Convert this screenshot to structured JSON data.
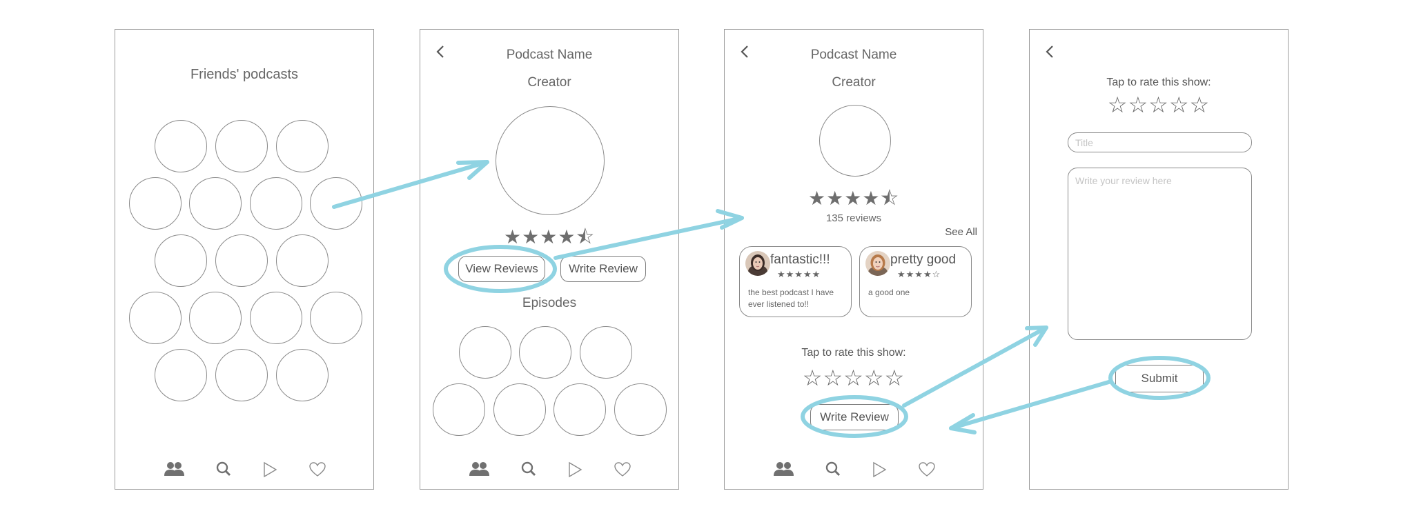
{
  "screen_friends": {
    "title": "Friends' podcasts"
  },
  "screen_podcast": {
    "podcast_name": "Podcast Name",
    "creator": "Creator",
    "rating_stars": "★★★★⯪",
    "view_reviews_label": "View Reviews",
    "write_review_label": "Write Review",
    "episodes_heading": "Episodes"
  },
  "screen_reviews": {
    "podcast_name": "Podcast Name",
    "creator": "Creator",
    "rating_stars": "★★★★⯪",
    "review_count": "135 reviews",
    "see_all_label": "See All",
    "reviews": [
      {
        "title": "fantastic!!!",
        "stars": "★★★★★",
        "body": "the best podcast I have ever listened to!!"
      },
      {
        "title": "pretty good",
        "stars": "★★★★☆",
        "body": "a good one"
      }
    ],
    "tap_to_rate": "Tap to rate this show:",
    "write_review_label": "Write Review"
  },
  "screen_write": {
    "tap_to_rate": "Tap to rate this show:",
    "title_placeholder": "Title",
    "review_placeholder": "Write your review here",
    "submit_label": "Submit"
  },
  "rate_stars": "☆☆☆☆☆",
  "nav_icons": [
    "friends-icon",
    "search-icon",
    "play-icon",
    "heart-icon"
  ],
  "colors": {
    "annotation": "#8fd3e2",
    "stroke": "#8a8a8a",
    "icon": "#707070"
  }
}
